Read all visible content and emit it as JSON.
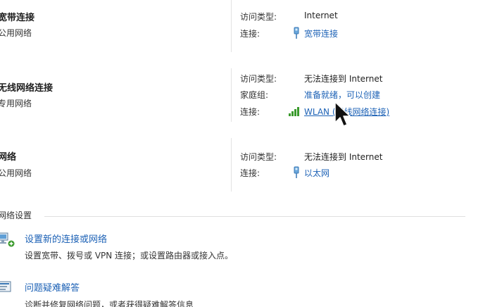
{
  "networks": [
    {
      "name": "宽带连接",
      "type": "公用网络",
      "rows": [
        {
          "key": "访问类型:",
          "value": "Internet"
        },
        {
          "key": "连接:",
          "link": "宽带连接",
          "icon": "ethernet-plug-icon"
        }
      ]
    },
    {
      "name": "无线网络连接",
      "type": "专用网络",
      "rows": [
        {
          "key": "访问类型:",
          "value": "无法连接到 Internet"
        },
        {
          "key": "家庭组:",
          "link": "准备就绪，可以创建"
        },
        {
          "key": "连接:",
          "link": "WLAN (无线网络连接)",
          "icon": "wifi-signal-icon"
        }
      ]
    },
    {
      "name": "网络",
      "type": "公用网络",
      "rows": [
        {
          "key": "访问类型:",
          "value": "无法连接到 Internet"
        },
        {
          "key": "连接:",
          "link": "以太网",
          "icon": "ethernet-plug-icon"
        }
      ]
    }
  ],
  "settings": {
    "section_label": "网络设置",
    "tasks": [
      {
        "title": "设置新的连接或网络",
        "description": "设置宽带、拨号或 VPN 连接；或设置路由器或接入点。",
        "icon": "new-connection-icon"
      },
      {
        "title": "问题疑难解答",
        "description": "诊断并修复网络问题，或者获得疑难解答信息",
        "icon": "troubleshoot-icon"
      }
    ]
  },
  "colors": {
    "link": "#1d62b6",
    "text": "#222222",
    "divider": "#e3e3e3",
    "wifi_signal": "#3a9a2c"
  }
}
